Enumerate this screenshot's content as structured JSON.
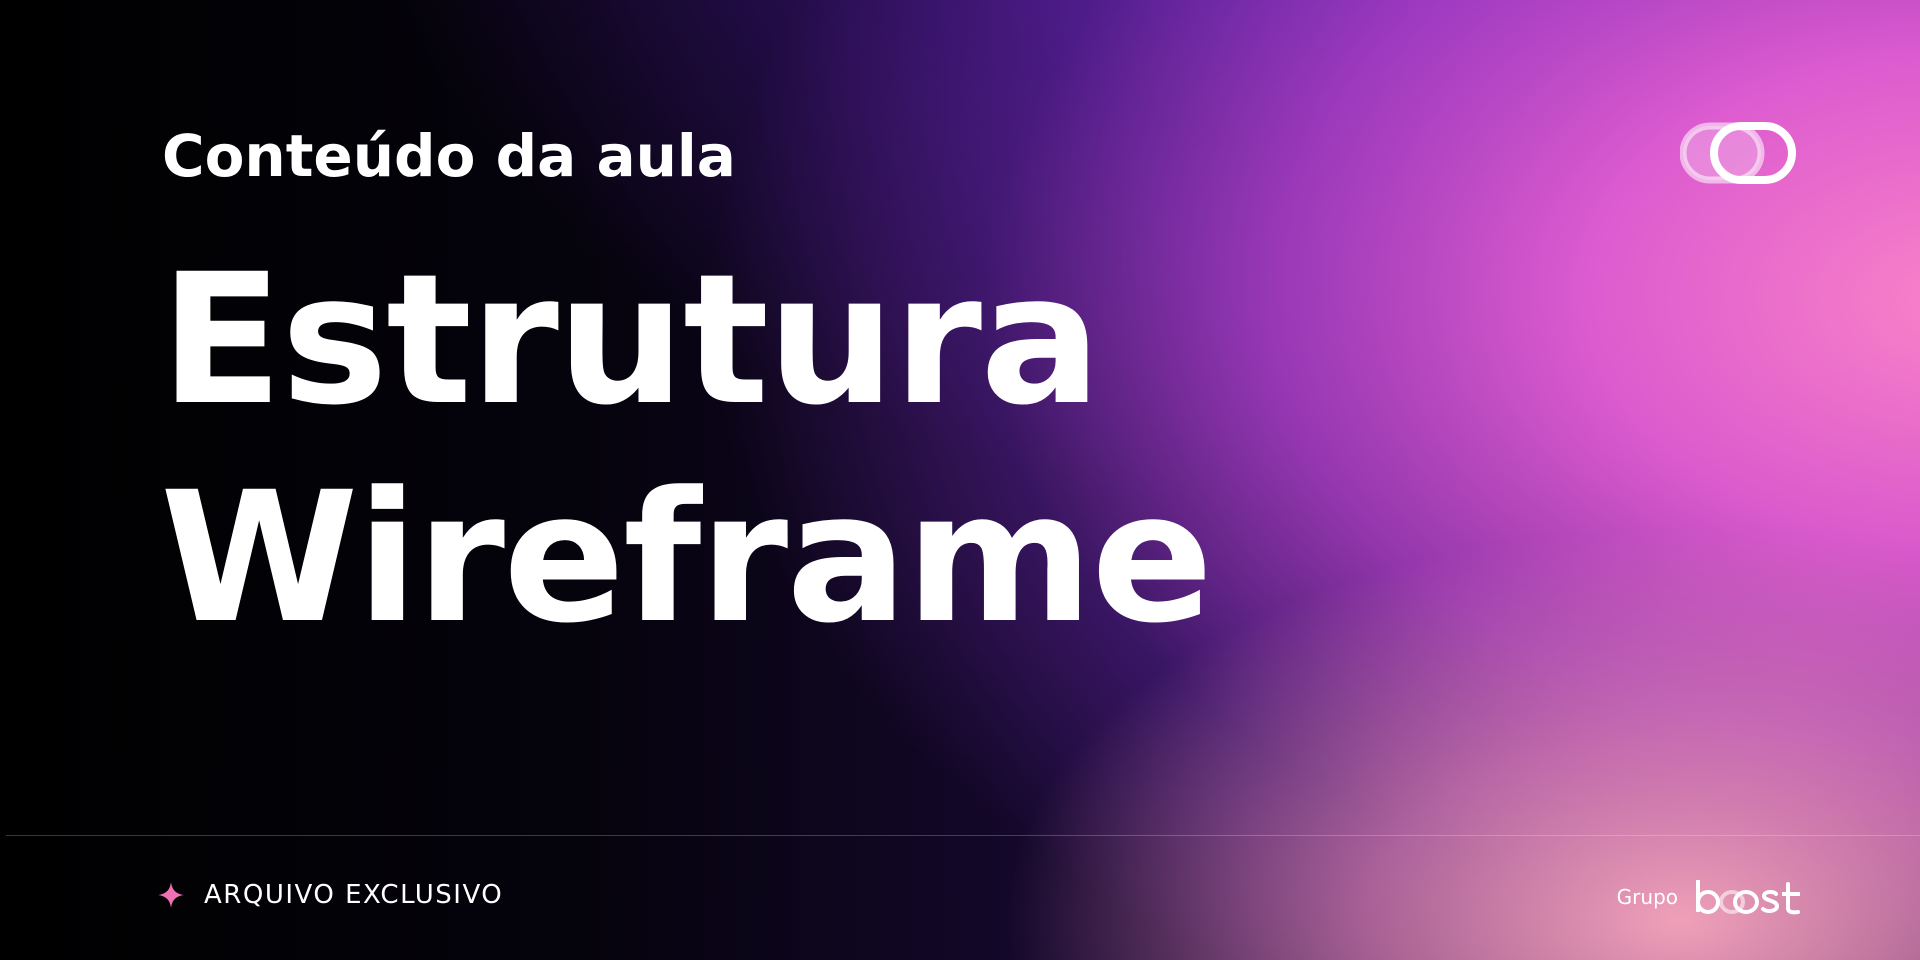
{
  "header": {
    "subtitle": "Conteúdo da aula",
    "title_line1": "Estrutura",
    "title_line2": "Wireframe"
  },
  "logo_mark": {
    "icon": "linked-rings-logo-icon"
  },
  "footer": {
    "badge_icon": "sparkle-icon",
    "label": "ARQUIVO EXCLUSIVO",
    "brand_prefix": "Grupo",
    "brand_name": "boost"
  },
  "colors": {
    "text": "#ffffff",
    "accent_pink": "#f070b4",
    "background_dark": "#000000",
    "gradient_purple": "#6a2ac0",
    "gradient_pink": "#f484c8",
    "gradient_peach": "#f7a3b8"
  }
}
